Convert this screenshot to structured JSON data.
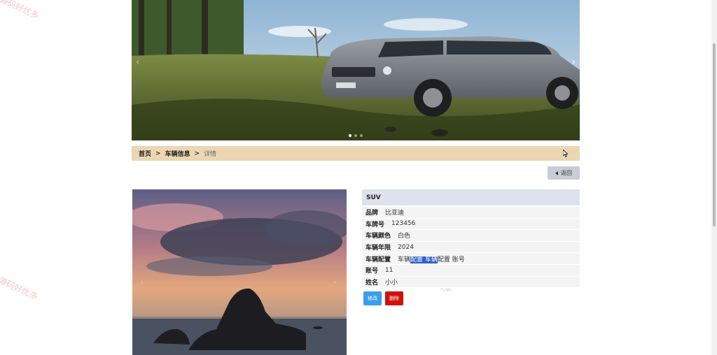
{
  "watermark": {
    "text": "源码好优多"
  },
  "hero": {
    "arrow_left": "‹",
    "arrow_right": "›",
    "dots": 3,
    "active_dot": 1
  },
  "breadcrumb": {
    "home": "首页",
    "separator": ">",
    "section": "车辆信息",
    "current": "详情"
  },
  "back_button": {
    "icon": "caret-left-icon",
    "label": "返回"
  },
  "photo": {
    "arrow_left": "‹",
    "arrow_right": "›"
  },
  "detail": {
    "title": "SUV",
    "rows": [
      {
        "label": "品牌",
        "value": "比亚迪"
      },
      {
        "label": "车牌号",
        "value": "123456"
      },
      {
        "label": "车辆颜色",
        "value": "白色"
      },
      {
        "label": "车辆年限",
        "value": "2024"
      },
      {
        "label": "车辆配置",
        "value_parts": [
          "车辆",
          "配置 车辆",
          "配置 账号"
        ]
      },
      {
        "label": "账号",
        "value": "11"
      },
      {
        "label": "姓名",
        "value": "小小"
      }
    ]
  },
  "actions": {
    "edit": "修改",
    "delete": "删除"
  },
  "colors": {
    "breadcrumb_bg": "#ecd6b3",
    "edit": "#3d9df0",
    "delete": "#d1120c",
    "selection": "#2f5fc7",
    "panel_header": "#dde2ec"
  }
}
